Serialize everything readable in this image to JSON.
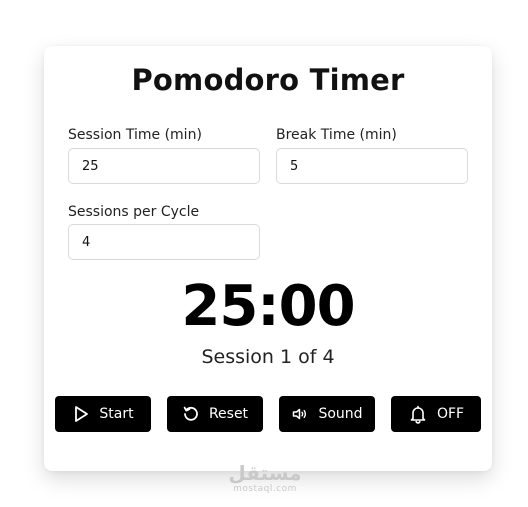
{
  "app": {
    "title": "Pomodoro Timer"
  },
  "settings": {
    "session_time": {
      "label": "Session Time (min)",
      "value": "25"
    },
    "break_time": {
      "label": "Break Time (min)",
      "value": "5"
    },
    "sessions_per_cycle": {
      "label": "Sessions per Cycle",
      "value": "4"
    }
  },
  "timer": {
    "display": "25:00",
    "session_status": "Session 1 of 4"
  },
  "controls": {
    "start_label": "Start",
    "reset_label": "Reset",
    "sound_label": "Sound",
    "notification_label": "OFF",
    "start_icon": "play-icon",
    "reset_icon": "reset-icon",
    "sound_icon": "speaker-icon",
    "notification_icon": "bell-icon"
  },
  "colors": {
    "button_background": "#000000",
    "button_text": "#ffffff",
    "timer_text": "#000000"
  },
  "watermark": {
    "logo_text": "مستقل",
    "url": "mostaql.com"
  }
}
